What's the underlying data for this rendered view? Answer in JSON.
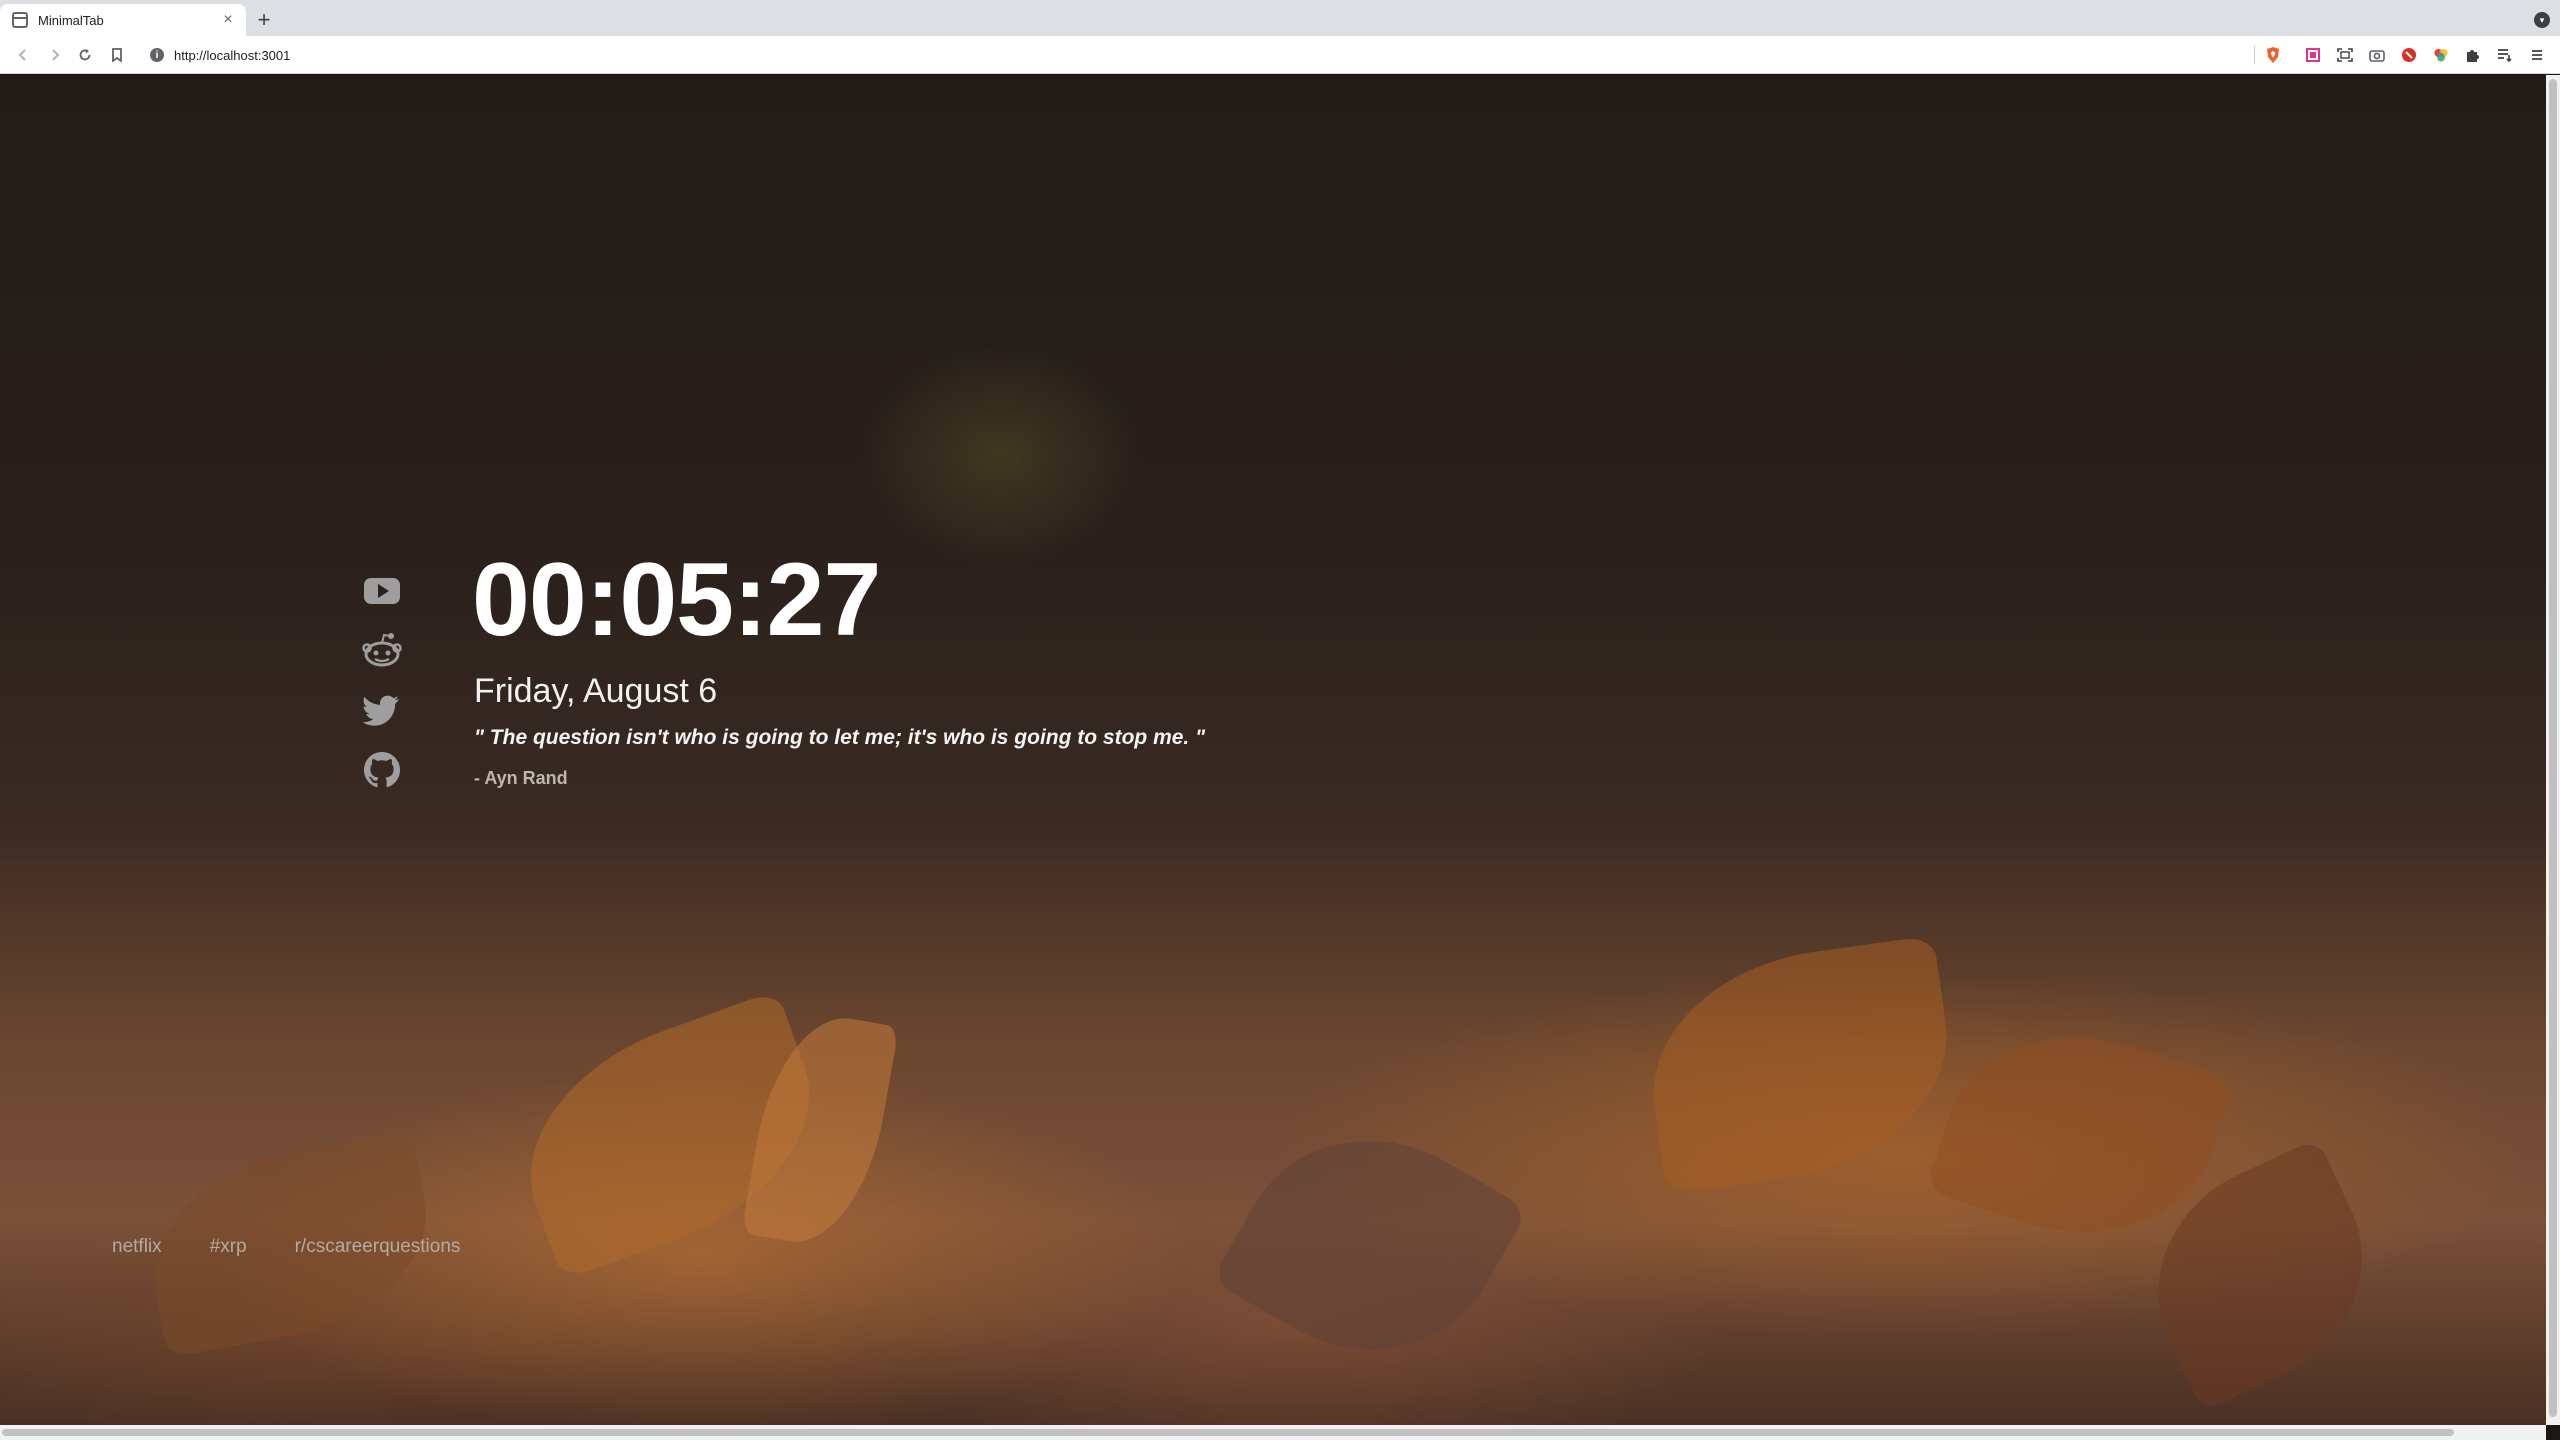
{
  "browser": {
    "tab_title": "MinimalTab",
    "tab_close": "×",
    "new_tab": "+",
    "url": "http://localhost:3001",
    "lock_glyph": "i"
  },
  "toolbar": {
    "back_icon": "back-icon",
    "forward_icon": "forward-icon",
    "reload_icon": "reload-icon",
    "bookmark_icon": "bookmark-icon",
    "extensions": [
      "brave-shield-icon",
      "extension-pink-icon",
      "screenshot-icon",
      "camera-icon",
      "extension-red-icon",
      "extension-color-icon",
      "puzzle-icon",
      "reading-list-icon",
      "menu-icon"
    ]
  },
  "social": [
    "youtube-icon",
    "reddit-icon",
    "twitter-icon",
    "github-icon"
  ],
  "clock": {
    "time": "00:05:27",
    "date": "Friday, August 6"
  },
  "quote": {
    "text": "\" The question isn't who is going to let me; it's who is going to stop me. \"",
    "author": "- Ayn Rand"
  },
  "bookmarks": [
    "netflix",
    "#xrp",
    "r/cscareerquestions"
  ]
}
